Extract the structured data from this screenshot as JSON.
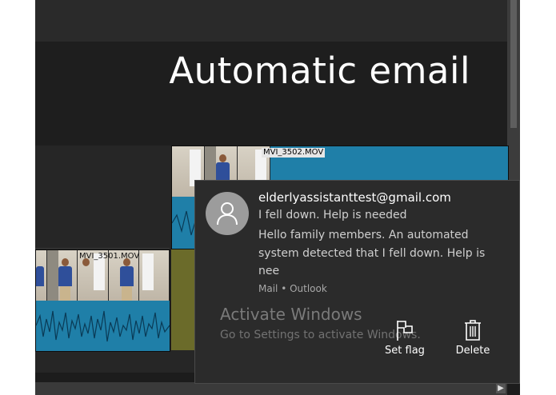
{
  "video_editor": {
    "title_overlay": "Automatic email",
    "clips": [
      {
        "name": "MVI_3501.MOV",
        "color": "#1f7fa8"
      },
      {
        "name": "MVI_3502.MOV",
        "color": "#1f7fa8"
      }
    ]
  },
  "notification": {
    "sender": "elderlyassistanttest@gmail.com",
    "subject": "I fell down. Help is needed",
    "body": "Hello family members. An automated system detected that I fell down. Help is nee",
    "source": "Mail • Outlook",
    "actions": [
      {
        "label": "Set flag",
        "icon": "flag-icon"
      },
      {
        "label": "Delete",
        "icon": "trash-icon"
      }
    ]
  },
  "activation_watermark": {
    "title": "Activate Windows",
    "subtitle": "Go to Settings to activate Windows."
  }
}
